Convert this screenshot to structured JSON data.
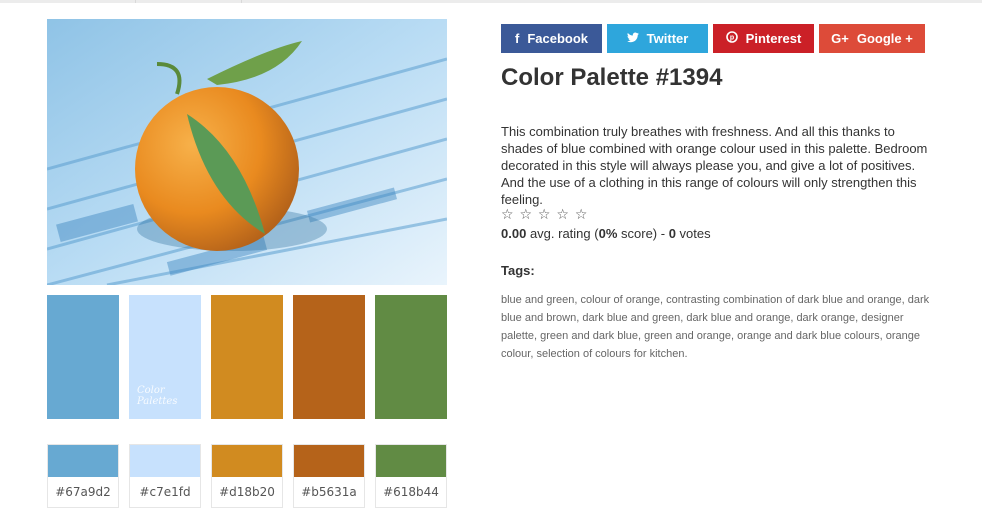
{
  "share_buttons": [
    {
      "label": "Facebook",
      "icon": "f",
      "color": "#3b5998"
    },
    {
      "label": "Twitter",
      "icon": "twitter-bird",
      "color": "#2ea6dc"
    },
    {
      "label": "Pinterest",
      "icon": "p",
      "color": "#cb2027"
    },
    {
      "label": "Google +",
      "icon": "G+",
      "color": "#dd4b39"
    }
  ],
  "palette": {
    "title": "Color Palette #1394",
    "description": "This combination truly breathes with freshness. And all this thanks to shades of blue combined with orange colour used in this palette. Bedroom decorated in this style will always please you, and give a lot of positives. And the use of a clothing in this range of colours will only strengthen this feeling.",
    "watermark_line1": "Color",
    "watermark_line2": "Palettes",
    "swatches": [
      {
        "hex": "#67a9d2"
      },
      {
        "hex": "#c7e1fd"
      },
      {
        "hex": "#d18b20"
      },
      {
        "hex": "#b5631a"
      },
      {
        "hex": "#618b44"
      }
    ]
  },
  "rating": {
    "stars": [
      "☆",
      "☆",
      "☆",
      "☆",
      "☆"
    ],
    "avg": "0.00",
    "avg_label": "avg. rating (",
    "score": "0%",
    "score_label": "score) - ",
    "votes": "0",
    "votes_label": "votes"
  },
  "tags": {
    "heading": "Tags:",
    "items": [
      "blue and green",
      "colour of orange",
      "contrasting combination of dark blue and orange",
      "dark blue and brown",
      "dark blue and green",
      "dark blue and orange",
      "dark orange",
      "designer palette",
      "green and dark blue",
      "green and orange",
      "orange and dark blue colours",
      "orange colour",
      "selection of colours for kitchen."
    ]
  }
}
